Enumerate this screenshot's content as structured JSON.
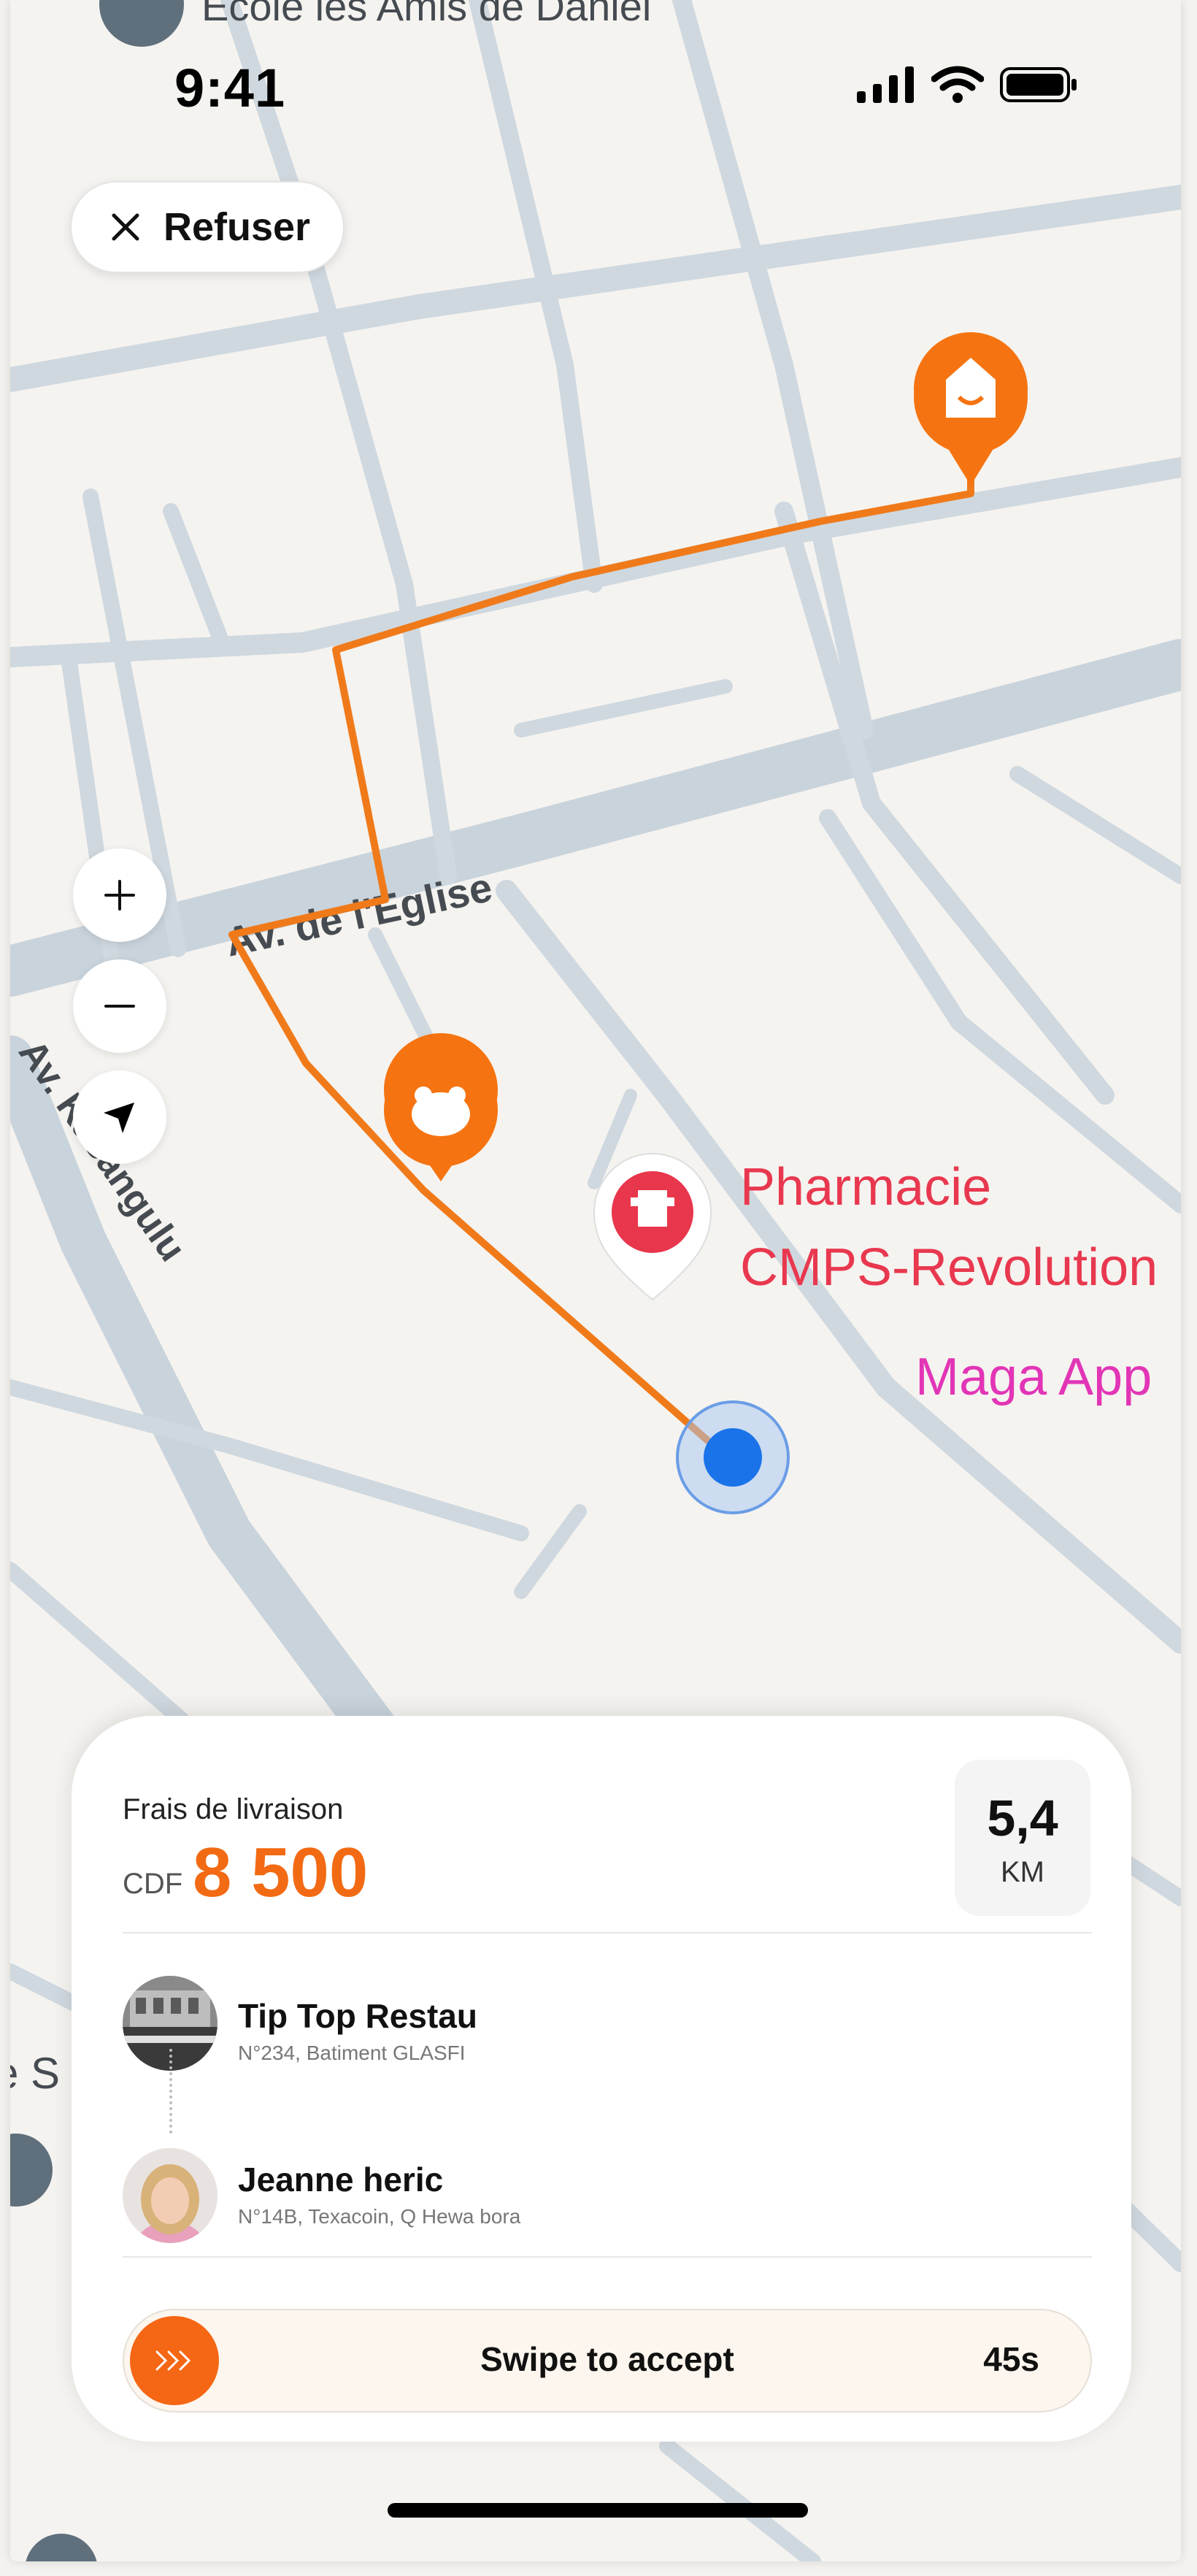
{
  "status_bar": {
    "time": "9:41"
  },
  "top_button": {
    "label": "Refuser",
    "icon": "close-icon"
  },
  "map": {
    "street_labels": [
      "Av. de l'Eglise",
      "Av. Kasangulu",
      "Ecole les Amis de Daniel",
      "e S"
    ],
    "poi_labels": {
      "pharmacy_line1": "Pharmacie",
      "pharmacy_line2": "CMPS-Revolution",
      "shop": "Maga App"
    },
    "route_color": "#f07a1a",
    "pin_color": "#f57411",
    "location_color": "#1a73e8",
    "controls": [
      "zoom-in-icon",
      "zoom-out-icon",
      "recenter-icon"
    ]
  },
  "delivery": {
    "fee_label": "Frais de livraison",
    "currency": "CDF",
    "amount": "8 500",
    "distance_value": "5,4",
    "distance_unit": "KM",
    "pickup": {
      "name": "Tip Top Restau",
      "address": "N°234, Batiment GLASFI"
    },
    "dropoff": {
      "name": "Jeanne heric",
      "address": "N°14B, Texacoin, Q Hewa bora"
    },
    "swipe_label": "Swipe to accept",
    "timer": "45s",
    "accent_color": "#f26a13"
  }
}
